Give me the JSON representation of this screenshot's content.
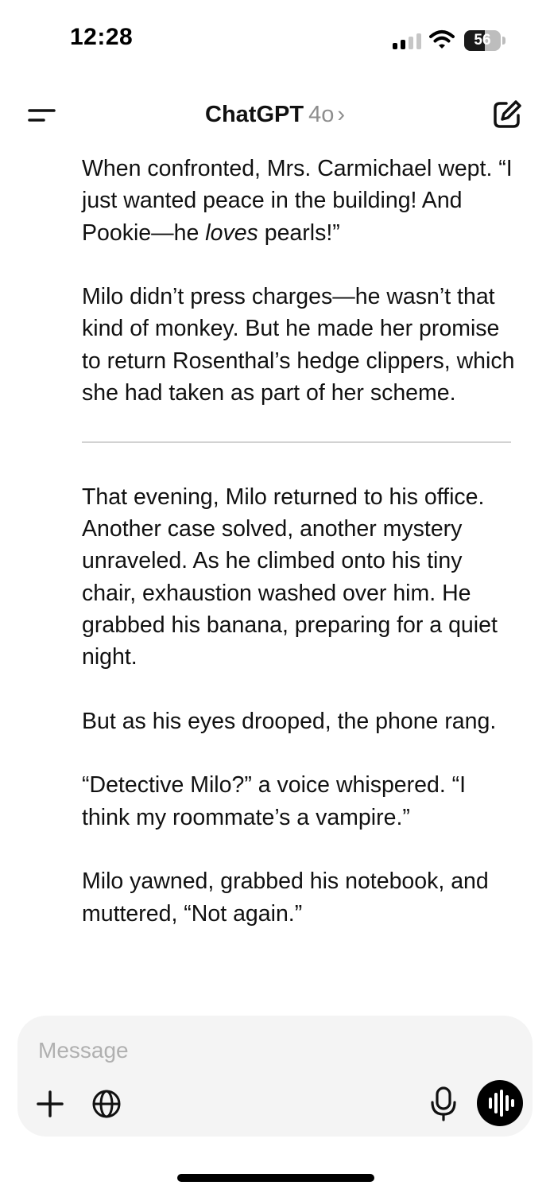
{
  "status_bar": {
    "time": "12:28",
    "battery_percent": "56",
    "battery_level": 0.56
  },
  "header": {
    "title": "ChatGPT",
    "model": "4o",
    "chevron": "›",
    "menu_icon": "menu-icon",
    "new_chat_icon": "compose-icon"
  },
  "messages": {
    "p1_a": "When confronted, Mrs. Carmichael wept. “I just wanted peace in the building! And Pookie—he ",
    "p1_em": "loves",
    "p1_b": " pearls!”",
    "p2": "Milo didn’t press charges—he wasn’t that kind of monkey. But he made her promise to return Rosenthal’s hedge clippers, which she had taken as part of her scheme.",
    "p3": "That evening, Milo returned to his office. Another case solved, another mystery unraveled. As he climbed onto his tiny chair, exhaustion washed over him. He grabbed his banana, preparing for a quiet night.",
    "p4": "But as his eyes drooped, the phone rang.",
    "p5": "“Detective Milo?” a voice whispered. “I think my roommate’s a vampire.”",
    "p6": "Milo yawned, grabbed his notebook, and muttered, “Not again.”"
  },
  "composer": {
    "placeholder": "Message",
    "value": "",
    "icons": [
      "plus-icon",
      "globe-icon",
      "microphone-icon",
      "voice-mode-icon"
    ]
  }
}
